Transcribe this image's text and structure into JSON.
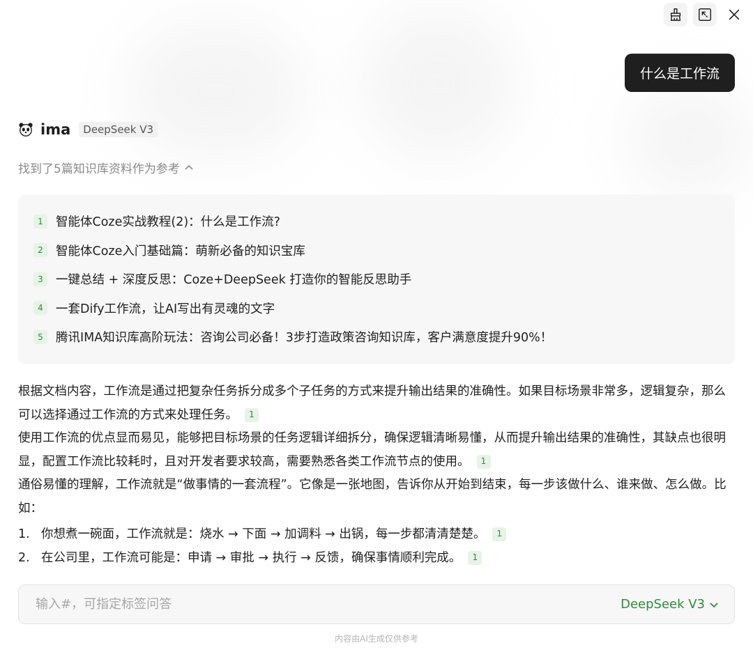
{
  "toolbar": {
    "icons": [
      "broom-icon",
      "shrink-icon",
      "close-icon"
    ]
  },
  "user_message": "什么是工作流",
  "bot": {
    "name": "ima",
    "model_tag": "DeepSeek V3"
  },
  "refs": {
    "toggle_label": "找到了5篇知识库资料作为参考",
    "items": [
      {
        "num": "1",
        "title": "智能体Coze实战教程(2)：什么是工作流?"
      },
      {
        "num": "2",
        "title": "智能体Coze入门基础篇：萌新必备的知识宝库"
      },
      {
        "num": "3",
        "title": "一键总结 + 深度反思：Coze+DeepSeek 打造你的智能反思助手"
      },
      {
        "num": "4",
        "title": "一套Dify工作流，让AI写出有灵魂的文字"
      },
      {
        "num": "5",
        "title": "腾讯IMA知识库高阶玩法：咨询公司必备！3步打造政策咨询知识库，客户满意度提升90%！"
      }
    ]
  },
  "answer": {
    "p1": "根据文档内容，工作流是通过把复杂任务拆分成多个子任务的方式来提升输出结果的准确性。如果目标场景非常多，逻辑复杂，那么可以选择通过工作流的方式来处理任务。",
    "p1_cite": "1",
    "p2": "使用工作流的优点显而易见，能够把目标场景的任务逻辑详细拆分，确保逻辑清晰易懂，从而提升输出结果的准确性，其缺点也很明显，配置工作流比较耗时，且对开发者要求较高，需要熟悉各类工作流节点的使用。",
    "p2_cite": "1",
    "p3": "通俗易懂的理解，工作流就是“做事情的一套流程”。它像是一张地图，告诉你从开始到结束，每一步该做什么、谁来做、怎么做。比如：",
    "list": [
      {
        "num": "1.",
        "text": "你想煮一碗面，工作流就是：烧水 → 下面 → 加调料 → 出锅，每一步都清清楚楚。",
        "cite": "1"
      },
      {
        "num": "2.",
        "text": "在公司里，工作流可能是：申请 → 审批 → 执行 → 反馈，确保事情顺利完成。",
        "cite": "1"
      }
    ]
  },
  "input": {
    "placeholder": "输入#，可指定标签问答",
    "model_select": "DeepSeek V3"
  },
  "footer": {
    "disclaimer": "内容由AI生成仅供参考"
  },
  "colors": {
    "accent_green": "#2e8b3a",
    "user_bubble_bg": "#1f1f1f",
    "cite_bg": "#e6f3e6"
  }
}
